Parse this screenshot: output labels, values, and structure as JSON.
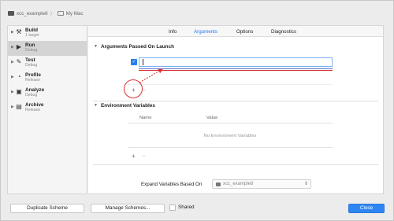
{
  "header": {
    "project": "xcc_example8",
    "separator": "〉",
    "destination": "My Mac"
  },
  "sidebar": {
    "items": [
      {
        "title": "Build",
        "subtitle": "1 target",
        "icon": "hammer-icon",
        "glyph": "⚒"
      },
      {
        "title": "Run",
        "subtitle": "Debug",
        "icon": "play-icon",
        "glyph": "▶"
      },
      {
        "title": "Test",
        "subtitle": "Debug",
        "icon": "wrench-icon",
        "glyph": "🔧"
      },
      {
        "title": "Profile",
        "subtitle": "Release",
        "icon": "gauge-icon",
        "glyph": "◔"
      },
      {
        "title": "Analyze",
        "subtitle": "Debug",
        "icon": "analyze-icon",
        "glyph": "▣"
      },
      {
        "title": "Archive",
        "subtitle": "Release",
        "icon": "archive-icon",
        "glyph": "▤"
      }
    ],
    "selected_index": 1
  },
  "tabs": [
    "Info",
    "Arguments",
    "Options",
    "Diagnostics"
  ],
  "active_tab": "Arguments",
  "arguments": {
    "section_title": "Arguments Passed On Launch",
    "row_value": "",
    "add_symbol": "+",
    "remove_symbol": "−"
  },
  "environment": {
    "section_title": "Environment Variables",
    "col_name": "Name",
    "col_value": "Value",
    "empty_text": "No Environment Variables",
    "add_symbol": "+",
    "remove_symbol": "−"
  },
  "expand": {
    "label": "Expand Variables Based On",
    "selected": "xcc_example8"
  },
  "footer": {
    "duplicate": "Duplicate Scheme",
    "manage": "Manage Schemes...",
    "shared": "Shared",
    "close": "Close"
  },
  "colors": {
    "accent": "#1b7cf0",
    "annotation": "#d9312f"
  }
}
